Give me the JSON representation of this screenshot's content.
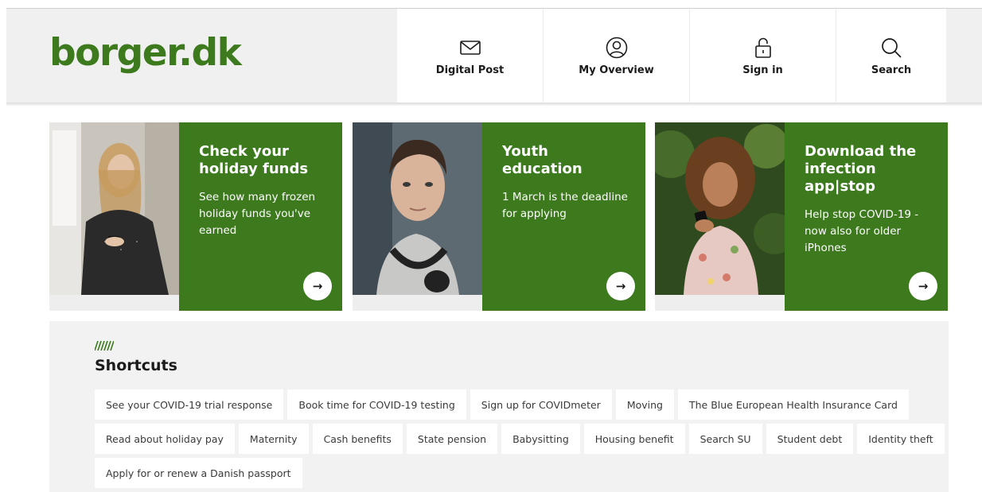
{
  "header": {
    "logo": "borger.dk",
    "nav": [
      {
        "label": "Digital Post",
        "icon": "envelope-icon"
      },
      {
        "label": "My Overview",
        "icon": "user-circle-icon"
      },
      {
        "label": "Sign in",
        "icon": "lock-icon"
      },
      {
        "label": "Search",
        "icon": "search-icon"
      }
    ]
  },
  "cards": [
    {
      "title": "Check your holiday funds",
      "text": "See how many frozen holiday funds you've earned",
      "arrow": "→"
    },
    {
      "title": "Youth education",
      "text": "1 March is the deadline for applying",
      "arrow": "→"
    },
    {
      "title": "Download the infection app|stop",
      "text": "Help stop COVID-19 - now also for older iPhones",
      "arrow": "→"
    }
  ],
  "shortcuts": {
    "title": "Shortcuts",
    "rows": [
      [
        "See your COVID-19 trial response",
        "Book time for COVID-19 testing",
        "Sign up for COVIDmeter",
        "Moving",
        "The Blue European Health Insurance Card"
      ],
      [
        "Read about holiday pay",
        "Maternity",
        "Cash benefits",
        "State pension",
        "Babysitting",
        "Housing benefit",
        "Search SU",
        "Student debt",
        "Identity theft"
      ],
      [
        "Apply for or renew a Danish passport"
      ]
    ]
  },
  "colors": {
    "brand_green": "#3c7a1d",
    "header_bg": "#f0f0f0",
    "shortcuts_bg": "#f2f2f2"
  }
}
